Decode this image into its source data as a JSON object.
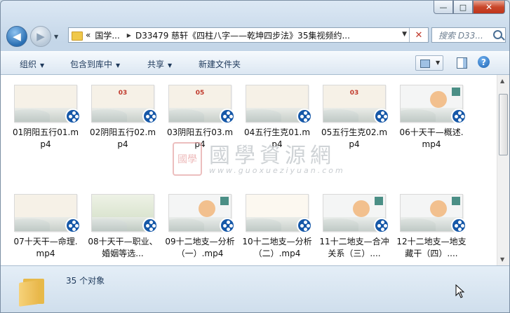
{
  "window": {
    "buttons": {
      "minimize": "—",
      "maximize": "□",
      "close": "✕"
    }
  },
  "address": {
    "history_symbol": "«",
    "crumbs": [
      "国学...",
      "D33479 慈轩《四柱八字——乾坤四步法》35集视频约..."
    ],
    "refresh_symbol": "✕"
  },
  "search": {
    "placeholder": "搜索 D33..."
  },
  "toolbar": {
    "organize": "组织",
    "include_library": "包含到库中",
    "share": "共享",
    "new_folder": "新建文件夹",
    "help": "?"
  },
  "files": [
    {
      "label": "01阴阳五行01.mp4",
      "thumb": "cream"
    },
    {
      "label": "02阴阳五行02.mp4",
      "thumb": "cream",
      "slide_num": "03"
    },
    {
      "label": "03阴阳五行03.mp4",
      "thumb": "cream",
      "slide_num": "05"
    },
    {
      "label": "04五行生克01.mp4",
      "thumb": "cream"
    },
    {
      "label": "05五行生克02.mp4",
      "thumb": "cream",
      "slide_num": "03"
    },
    {
      "label": "06十天干—概述.mp4",
      "thumb": "gray"
    },
    {
      "label": "07十天干—命理.mp4",
      "thumb": "cream"
    },
    {
      "label": "08十天干—职业、婚姻等选...",
      "thumb": "green"
    },
    {
      "label": "09十二地支—分析（一）.mp4",
      "thumb": "gray"
    },
    {
      "label": "10十二地支—分析（二）.mp4",
      "thumb": "chart"
    },
    {
      "label": "11十二地支—合冲关系（三）....",
      "thumb": "gray"
    },
    {
      "label": "12十二地支—地支藏干（四）....",
      "thumb": "gray"
    }
  ],
  "watermark": {
    "seal": "國學",
    "text": "國學資源網",
    "url": "www.guoxueziyuan.com"
  },
  "status": {
    "count": "35 个对象"
  }
}
